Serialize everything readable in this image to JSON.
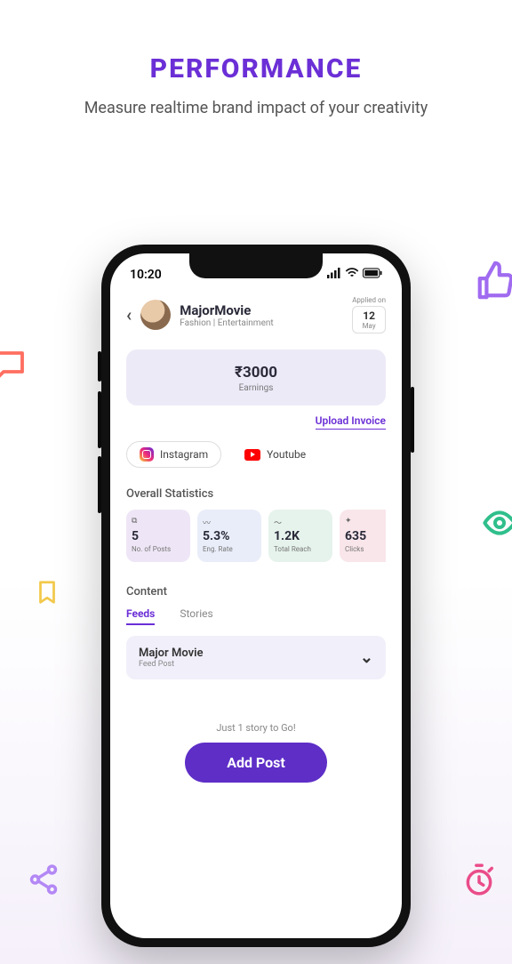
{
  "page": {
    "title": "PERFORMANCE",
    "subtitle": "Measure realtime brand impact of your creativity"
  },
  "status_bar": {
    "time": "10:20"
  },
  "header": {
    "profile_name": "MajorMovie",
    "profile_sub": "Fashion | Entertainment",
    "applied_label": "Applied on",
    "applied_day": "12",
    "applied_month": "May"
  },
  "earnings": {
    "value": "₹3000",
    "label": "Earnings"
  },
  "upload_invoice": "Upload Invoice",
  "platforms": {
    "instagram": "Instagram",
    "youtube": "Youtube"
  },
  "stats_title": "Overall Statistics",
  "stats": [
    {
      "value": "5",
      "label": "No. of Posts"
    },
    {
      "value": "5.3%",
      "label": "Eng. Rate"
    },
    {
      "value": "1.2K",
      "label": "Total Reach"
    },
    {
      "value": "635",
      "label": "Clicks"
    }
  ],
  "content_section": {
    "title": "Content",
    "tabs": {
      "feeds": "Feeds",
      "stories": "Stories"
    },
    "card": {
      "title": "Major Movie",
      "sub": "Feed Post"
    }
  },
  "footer": {
    "hint": "Just 1 story to Go!",
    "button": "Add Post"
  }
}
